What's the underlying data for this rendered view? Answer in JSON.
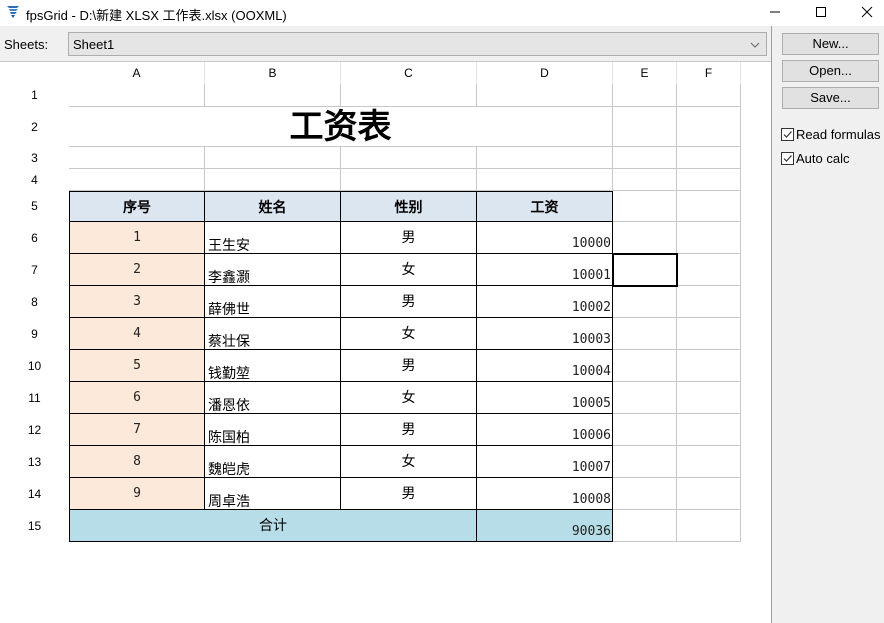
{
  "window": {
    "title": "fpsGrid - D:\\新建 XLSX 工作表.xlsx (OOXML)",
    "icon": "fpsgrid-app-icon",
    "controls": {
      "minimize": "minimize-icon",
      "maximize": "maximize-icon",
      "close": "close-icon"
    }
  },
  "sheets_bar": {
    "label": "Sheets:",
    "selected": "Sheet1"
  },
  "panel": {
    "buttons": {
      "new": "New...",
      "open": "Open...",
      "save": "Save..."
    },
    "checkboxes": [
      {
        "label": "Read formulas",
        "checked": true
      },
      {
        "label": "Auto calc",
        "checked": true
      }
    ]
  },
  "grid": {
    "columns": [
      "A",
      "B",
      "C",
      "D",
      "E",
      "F"
    ],
    "rows": [
      "1",
      "2",
      "3",
      "4",
      "5",
      "6",
      "7",
      "8",
      "9",
      "10",
      "11",
      "12",
      "13",
      "14",
      "15"
    ],
    "title": "工资表",
    "headers": [
      "序号",
      "姓名",
      "性别",
      "工资"
    ],
    "records": [
      {
        "no": "1",
        "name": "王生安",
        "sex": "男",
        "salary": "10000"
      },
      {
        "no": "2",
        "name": "李鑫灏",
        "sex": "女",
        "salary": "10001"
      },
      {
        "no": "3",
        "name": "薛佛世",
        "sex": "男",
        "salary": "10002"
      },
      {
        "no": "4",
        "name": "蔡壮保",
        "sex": "女",
        "salary": "10003"
      },
      {
        "no": "5",
        "name": "钱勤堃",
        "sex": "男",
        "salary": "10004"
      },
      {
        "no": "6",
        "name": "潘恩依",
        "sex": "女",
        "salary": "10005"
      },
      {
        "no": "7",
        "name": "陈国柏",
        "sex": "男",
        "salary": "10006"
      },
      {
        "no": "8",
        "name": "魏皑虎",
        "sex": "女",
        "salary": "10007"
      },
      {
        "no": "9",
        "name": "周卓浩",
        "sex": "男",
        "salary": "10008"
      }
    ],
    "total_label": "合计",
    "total_value": "90036",
    "selected_cell": "E7",
    "colors": {
      "header_fill": "#dce6f1",
      "index_fill": "#fde9d9",
      "total_fill": "#b7dee8"
    }
  }
}
